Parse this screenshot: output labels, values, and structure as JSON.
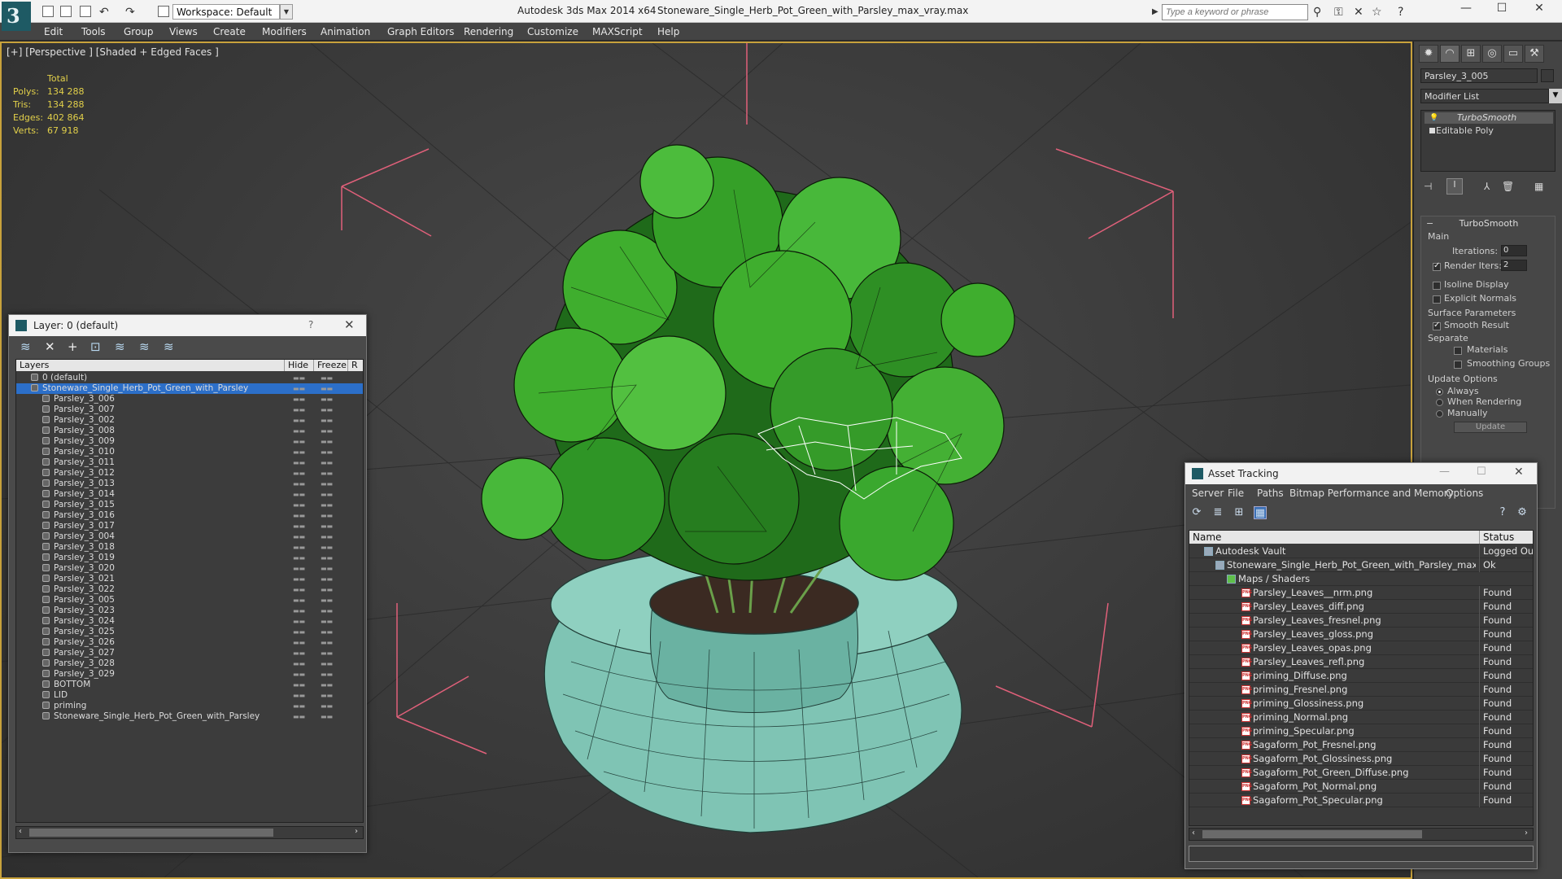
{
  "titlebar": {
    "app_title": "Autodesk 3ds Max  2014 x64",
    "file_name": "Stoneware_Single_Herb_Pot_Green_with_Parsley_max_vray.max",
    "workspace": "Workspace: Default",
    "search_placeholder": "Type a keyword or phrase"
  },
  "menu": [
    "Edit",
    "Tools",
    "Group",
    "Views",
    "Create",
    "Modifiers",
    "Animation",
    "Graph Editors",
    "Rendering",
    "Customize",
    "MAXScript",
    "Help"
  ],
  "viewport": {
    "label": "[+] [Perspective ] [Shaded + Edged Faces ]",
    "stats": {
      "header": "Total",
      "rows": [
        {
          "label": "Polys:",
          "value": "134 288"
        },
        {
          "label": "Tris:",
          "value": "134 288"
        },
        {
          "label": "Edges:",
          "value": "402 864"
        },
        {
          "label": "Verts:",
          "value": "67 918"
        }
      ]
    }
  },
  "command_panel": {
    "object_name": "Parsley_3_005",
    "modifier_list": "Modifier List",
    "stack": [
      "TurboSmooth",
      "Editable Poly"
    ],
    "turbosmooth": {
      "title": "TurboSmooth",
      "main_label": "Main",
      "iterations_label": "Iterations:",
      "iterations_value": "0",
      "render_iters_label": "Render Iters:",
      "render_iters_value": "2",
      "isoline": "Isoline Display",
      "explicit_normals": "Explicit Normals",
      "surface_params": "Surface Parameters",
      "smooth_result": "Smooth Result",
      "separate": "Separate",
      "materials": "Materials",
      "smoothing_groups": "Smoothing Groups",
      "update_options": "Update Options",
      "always": "Always",
      "when_rendering": "When Rendering",
      "manually": "Manually",
      "update_btn": "Update"
    }
  },
  "layer_window": {
    "title": "Layer: 0 (default)",
    "help": "?",
    "columns": [
      "Layers",
      "Hide",
      "Freeze",
      "R"
    ],
    "rows": [
      {
        "name": "0 (default)",
        "indent": 1,
        "selected": false
      },
      {
        "name": "Stoneware_Single_Herb_Pot_Green_with_Parsley",
        "indent": 1,
        "selected": true
      },
      {
        "name": "Parsley_3_006",
        "indent": 2,
        "selected": false
      },
      {
        "name": "Parsley_3_007",
        "indent": 2,
        "selected": false
      },
      {
        "name": "Parsley_3_002",
        "indent": 2,
        "selected": false
      },
      {
        "name": "Parsley_3_008",
        "indent": 2,
        "selected": false
      },
      {
        "name": "Parsley_3_009",
        "indent": 2,
        "selected": false
      },
      {
        "name": "Parsley_3_010",
        "indent": 2,
        "selected": false
      },
      {
        "name": "Parsley_3_011",
        "indent": 2,
        "selected": false
      },
      {
        "name": "Parsley_3_012",
        "indent": 2,
        "selected": false
      },
      {
        "name": "Parsley_3_013",
        "indent": 2,
        "selected": false
      },
      {
        "name": "Parsley_3_014",
        "indent": 2,
        "selected": false
      },
      {
        "name": "Parsley_3_015",
        "indent": 2,
        "selected": false
      },
      {
        "name": "Parsley_3_016",
        "indent": 2,
        "selected": false
      },
      {
        "name": "Parsley_3_017",
        "indent": 2,
        "selected": false
      },
      {
        "name": "Parsley_3_004",
        "indent": 2,
        "selected": false
      },
      {
        "name": "Parsley_3_018",
        "indent": 2,
        "selected": false
      },
      {
        "name": "Parsley_3_019",
        "indent": 2,
        "selected": false
      },
      {
        "name": "Parsley_3_020",
        "indent": 2,
        "selected": false
      },
      {
        "name": "Parsley_3_021",
        "indent": 2,
        "selected": false
      },
      {
        "name": "Parsley_3_022",
        "indent": 2,
        "selected": false
      },
      {
        "name": "Parsley_3_005",
        "indent": 2,
        "selected": false
      },
      {
        "name": "Parsley_3_023",
        "indent": 2,
        "selected": false
      },
      {
        "name": "Parsley_3_024",
        "indent": 2,
        "selected": false
      },
      {
        "name": "Parsley_3_025",
        "indent": 2,
        "selected": false
      },
      {
        "name": "Parsley_3_026",
        "indent": 2,
        "selected": false
      },
      {
        "name": "Parsley_3_027",
        "indent": 2,
        "selected": false
      },
      {
        "name": "Parsley_3_028",
        "indent": 2,
        "selected": false
      },
      {
        "name": "Parsley_3_029",
        "indent": 2,
        "selected": false
      },
      {
        "name": "BOTTOM",
        "indent": 2,
        "selected": false
      },
      {
        "name": "LID",
        "indent": 2,
        "selected": false
      },
      {
        "name": "priming",
        "indent": 2,
        "selected": false
      },
      {
        "name": "Stoneware_Single_Herb_Pot_Green_with_Parsley",
        "indent": 2,
        "selected": false
      }
    ]
  },
  "asset_window": {
    "title": "Asset Tracking",
    "menu": [
      "Server",
      "File",
      "Paths",
      "Bitmap Performance and Memory",
      "Options"
    ],
    "columns": [
      "Name",
      "Status"
    ],
    "rows": [
      {
        "name": "Autodesk Vault",
        "status": "Logged Out",
        "indent": 1,
        "kind": "vault"
      },
      {
        "name": "Stoneware_Single_Herb_Pot_Green_with_Parsley_max_v...",
        "status": "Ok",
        "indent": 2,
        "kind": "max"
      },
      {
        "name": "Maps / Shaders",
        "status": "",
        "indent": 3,
        "kind": "folder"
      },
      {
        "name": "Parsley_Leaves__nrm.png",
        "status": "Found",
        "indent": 4,
        "kind": "png"
      },
      {
        "name": "Parsley_Leaves_diff.png",
        "status": "Found",
        "indent": 4,
        "kind": "png"
      },
      {
        "name": "Parsley_Leaves_fresnel.png",
        "status": "Found",
        "indent": 4,
        "kind": "png"
      },
      {
        "name": "Parsley_Leaves_gloss.png",
        "status": "Found",
        "indent": 4,
        "kind": "png"
      },
      {
        "name": "Parsley_Leaves_opas.png",
        "status": "Found",
        "indent": 4,
        "kind": "png"
      },
      {
        "name": "Parsley_Leaves_refl.png",
        "status": "Found",
        "indent": 4,
        "kind": "png"
      },
      {
        "name": "priming_Diffuse.png",
        "status": "Found",
        "indent": 4,
        "kind": "png"
      },
      {
        "name": "priming_Fresnel.png",
        "status": "Found",
        "indent": 4,
        "kind": "png"
      },
      {
        "name": "priming_Glossiness.png",
        "status": "Found",
        "indent": 4,
        "kind": "png"
      },
      {
        "name": "priming_Normal.png",
        "status": "Found",
        "indent": 4,
        "kind": "png"
      },
      {
        "name": "priming_Specular.png",
        "status": "Found",
        "indent": 4,
        "kind": "png"
      },
      {
        "name": "Sagaform_Pot_Fresnel.png",
        "status": "Found",
        "indent": 4,
        "kind": "png"
      },
      {
        "name": "Sagaform_Pot_Glossiness.png",
        "status": "Found",
        "indent": 4,
        "kind": "png"
      },
      {
        "name": "Sagaform_Pot_Green_Diffuse.png",
        "status": "Found",
        "indent": 4,
        "kind": "png"
      },
      {
        "name": "Sagaform_Pot_Normal.png",
        "status": "Found",
        "indent": 4,
        "kind": "png"
      },
      {
        "name": "Sagaform_Pot_Specular.png",
        "status": "Found",
        "indent": 4,
        "kind": "png"
      }
    ]
  },
  "colors": {
    "viewport_border": "#c8a23c",
    "stats_text": "#e2d04a",
    "selection": "#2c6fc9",
    "pot_teal": "#7fc4b4",
    "leaf_green": "#3fae2e",
    "bbox_pink": "#e0607a"
  }
}
